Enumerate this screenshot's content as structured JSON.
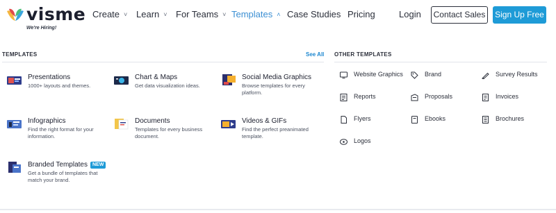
{
  "header": {
    "logo_text": "visme",
    "hiring_text": "We're Hiring!",
    "nav": [
      "Create",
      "Learn",
      "For Teams",
      "Templates",
      "Case Studies",
      "Pricing"
    ],
    "active_nav": "Templates",
    "login": "Login",
    "contact_sales": "Contact Sales",
    "sign_up": "Sign Up Free"
  },
  "templates": {
    "title": "TEMPLATES",
    "see_all": "See All",
    "items": [
      {
        "title": "Presentations",
        "desc": "1000+ layouts and themes.",
        "icon": "presentation-thumb-icon"
      },
      {
        "title": "Chart & Maps",
        "desc": "Get data visualization ideas.",
        "icon": "chart-map-thumb-icon"
      },
      {
        "title": "Social Media Graphics",
        "desc": "Browse templates for every platform.",
        "icon": "social-media-thumb-icon"
      },
      {
        "title": "Infographics",
        "desc": "Find the right format for your information.",
        "icon": "infographic-thumb-icon"
      },
      {
        "title": "Documents",
        "desc": "Templates for every business document.",
        "icon": "document-thumb-icon"
      },
      {
        "title": "Videos & GIFs",
        "desc": "Find the perfect preanimated template.",
        "icon": "video-thumb-icon"
      },
      {
        "title": "Branded Templates",
        "desc": "Get a bundle of templates that match your brand.",
        "badge": "NEW",
        "icon": "branded-thumb-icon"
      }
    ]
  },
  "other_templates": {
    "title": "OTHER TEMPLATES",
    "items": [
      {
        "label": "Website Graphics",
        "icon": "monitor-icon"
      },
      {
        "label": "Brand",
        "icon": "brand-tag-icon"
      },
      {
        "label": "Survey Results",
        "icon": "survey-icon"
      },
      {
        "label": "Reports",
        "icon": "report-icon"
      },
      {
        "label": "Proposals",
        "icon": "proposal-icon"
      },
      {
        "label": "Invoices",
        "icon": "invoice-icon"
      },
      {
        "label": "Flyers",
        "icon": "flyer-icon"
      },
      {
        "label": "Ebooks",
        "icon": "ebook-icon"
      },
      {
        "label": "Brochures",
        "icon": "brochure-icon"
      },
      {
        "label": "Logos",
        "icon": "logo-icon"
      }
    ]
  },
  "colors": {
    "accent": "#1e9bd7",
    "active_nav": "#3b8fd3",
    "text": "#1c1f2e"
  }
}
